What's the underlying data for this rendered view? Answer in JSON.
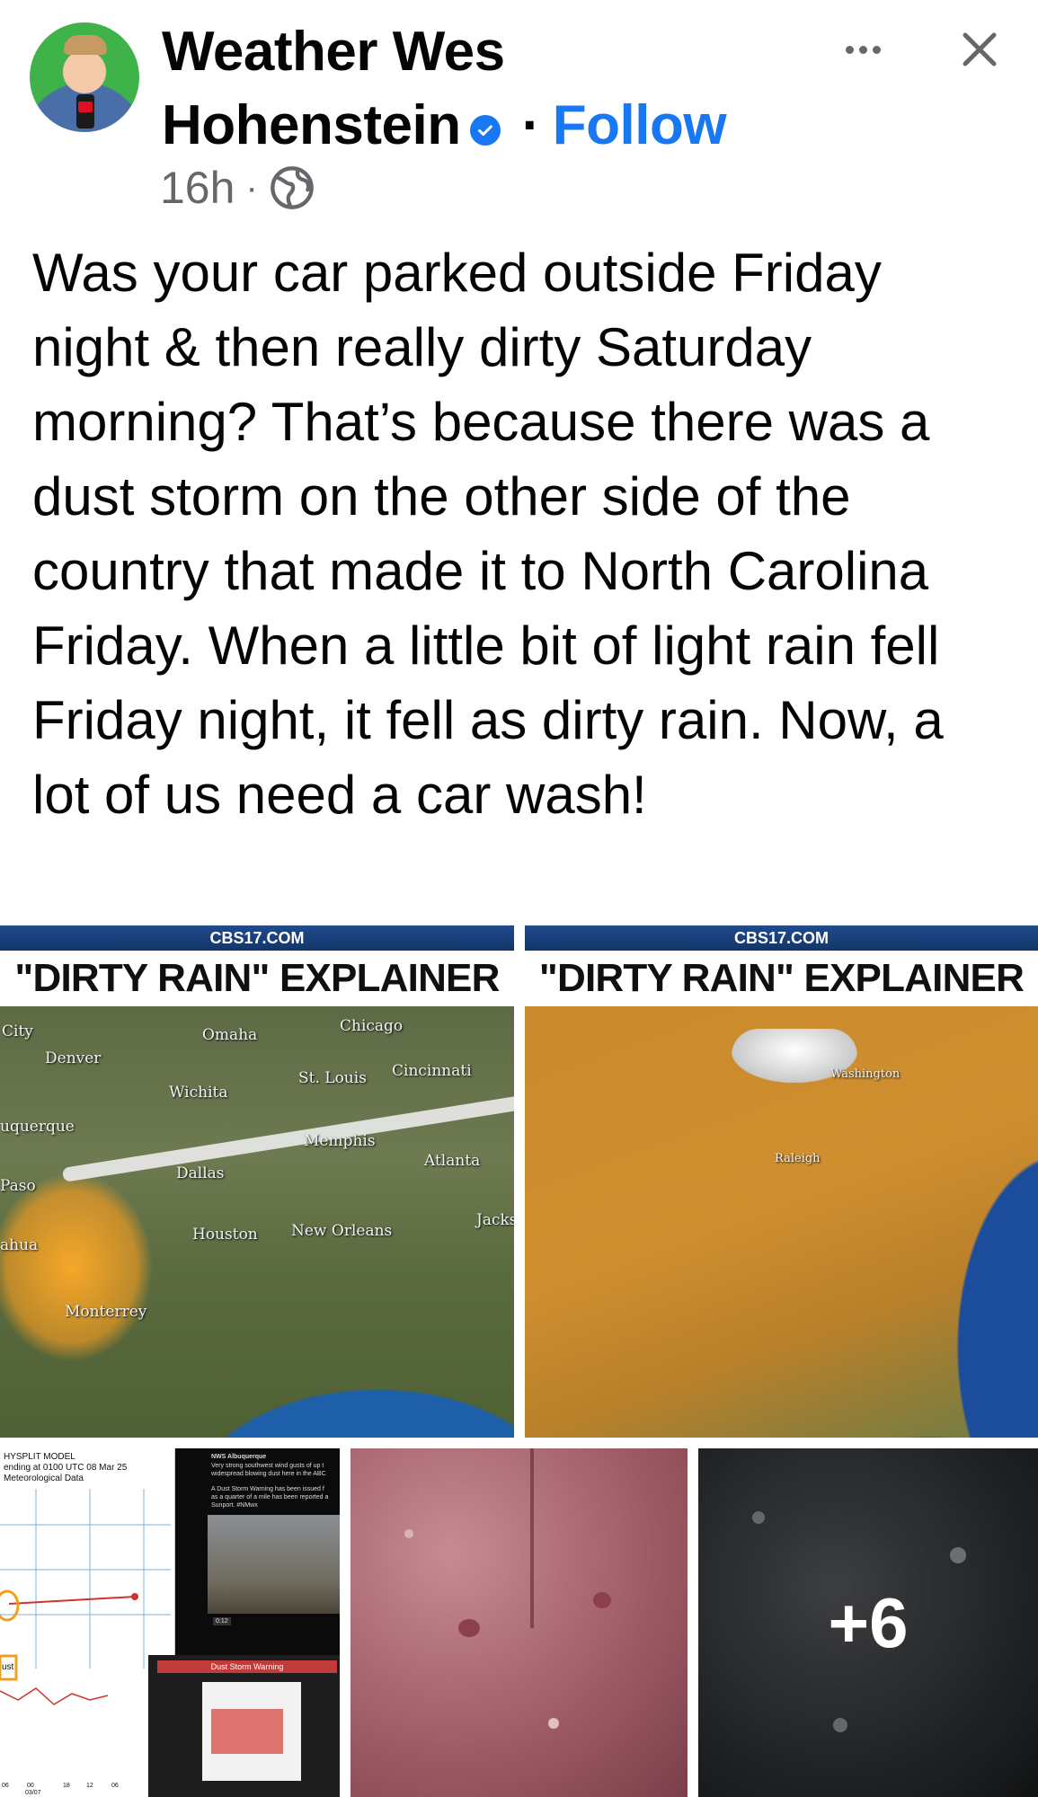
{
  "post": {
    "author": {
      "name_line1": "Weather Wes",
      "name_line2": "Hohenstein",
      "verified": true
    },
    "follow_label": "Follow",
    "separator": "·",
    "time": "16h",
    "audience_icon": "globe-icon",
    "text": "Was your car parked outside Friday night & then really dirty Saturday morning? That’s because there was a dust storm on the other side of the country that made it to North Carolina Friday. When a little bit of light rain fell Friday night, it fell as dirty rain. Now, a lot of us need a car wash!"
  },
  "actions": {
    "more_icon": "more-dots-icon",
    "close_icon": "close-icon"
  },
  "media": {
    "image1": {
      "site": "CBS17.COM",
      "title": "\"DIRTY RAIN\" EXPLAINER",
      "labels": [
        "City",
        "Denver",
        "Omaha",
        "Chicago",
        "St. Louis",
        "Cincinnati",
        "Wichita",
        "uquerque",
        "Memphis",
        "Atlanta",
        "Paso",
        "Dallas",
        "Jacks",
        "Houston",
        "New Orleans",
        "ahua",
        "Monterrey"
      ]
    },
    "image2": {
      "site": "CBS17.COM",
      "title": "\"DIRTY RAIN\" EXPLAINER",
      "labels": [
        "Washington",
        "Raleigh"
      ]
    },
    "image3": {
      "hysplit_lines": [
        "HYSPLIT MODEL",
        "ending at 0100 UTC 08 Mar 25",
        "Meteorological Data"
      ],
      "tweet_lines": [
        "NWS Albuquerque",
        "Very strong southwest wind gusts of up t",
        "widespread blowing dust here in the ABC",
        "A Dust Storm Warning has been issued f",
        "as a quarter of a mile has been reported a",
        "Sunport. #NMwx"
      ],
      "warning_title": "Dust Storm Warning",
      "video_time": "0:12",
      "axis_lines": [
        "06",
        "00",
        "18",
        "12",
        "06",
        "03/07"
      ],
      "dust_label": "ust"
    },
    "more_count": "+6"
  },
  "colors": {
    "accent": "#1877f2",
    "text": "#050505",
    "secondary": "#65676b"
  }
}
